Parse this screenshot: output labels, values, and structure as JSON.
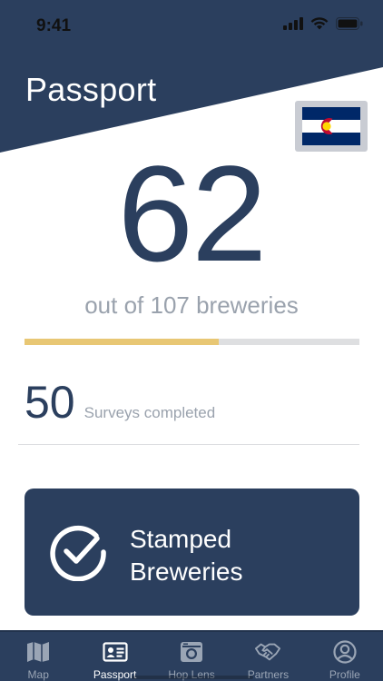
{
  "status": {
    "time": "9:41"
  },
  "header": {
    "title": "Passport",
    "bg_color": "#2b3f5e",
    "flag_icon": "colorado-flag-icon"
  },
  "stats": {
    "visited_count": "62",
    "total_label": "out of 107 breweries",
    "visited": 62,
    "total": 107,
    "progress_color": "#e8c774",
    "surveys_count": "50",
    "surveys_label": "Surveys completed"
  },
  "stamped_card": {
    "label_line1": "Stamped",
    "label_line2": "Breweries",
    "icon": "check-circle-icon"
  },
  "tabs": [
    {
      "label": "Map",
      "icon": "map-icon",
      "active": false
    },
    {
      "label": "Passport",
      "icon": "passport-card-icon",
      "active": true
    },
    {
      "label": "Hop Lens",
      "icon": "camera-icon",
      "active": false
    },
    {
      "label": "Partners",
      "icon": "handshake-icon",
      "active": false
    },
    {
      "label": "Profile",
      "icon": "profile-icon",
      "active": false
    }
  ],
  "colors": {
    "primary": "#2b3f5e",
    "accent": "#e8c774",
    "muted_text": "#9aa2ad"
  }
}
